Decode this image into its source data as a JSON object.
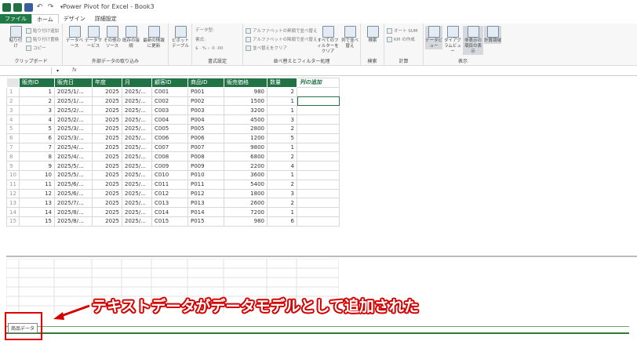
{
  "window": {
    "title": "Power Pivot for Excel - Book3"
  },
  "tabs": [
    "ファイル",
    "ホーム",
    "デザイン",
    "詳細設定"
  ],
  "ribbon": {
    "clipboard": {
      "label": "クリップボード",
      "paste": "貼り付け",
      "paste_append": "貼り付け追加",
      "paste_replace": "貼り付け置換",
      "copy": "コピー"
    },
    "external": {
      "label": "外部データの取り込み",
      "database": "データベース",
      "service": "データサービス",
      "other": "その他のソース",
      "existing": "既存の接続",
      "refresh": "最新の情報に更新"
    },
    "pivot": {
      "label": "ピボットテーブル"
    },
    "format": {
      "label": "書式設定",
      "datatype": "データ型:",
      "format": "書式:",
      "symbols": "$ · % › ·0 ·00"
    },
    "sort": {
      "label": "並べ替えとフィルター処理",
      "az": "アルファベットの昇順で並べ替え",
      "za": "アルファベットの降順で並べ替え",
      "clear_sort": "並べ替えをクリア",
      "clear_filter": "すべてのフィルターをクリア",
      "col_sort": "列で並べ替え"
    },
    "find": {
      "label": "検索",
      "find": "検索"
    },
    "calc": {
      "label": "計算",
      "autosum": "オート SUM",
      "kpi": "KPI の作成"
    },
    "view": {
      "label": "表示",
      "data": "データビュー",
      "diagram": "ダイアグラムビュー",
      "hidden": "非表示の項目の表示",
      "calc_area": "計算領域"
    }
  },
  "formula_bar": {
    "fx": "fx",
    "namebox_arrow": "▾"
  },
  "table": {
    "headers": [
      "販売ID",
      "販売日",
      "年度",
      "月",
      "顧客ID",
      "商品ID",
      "販売価格",
      "数量"
    ],
    "add_column": "列の追加",
    "rows": [
      [
        "1",
        "2025/1/...",
        "2025",
        "2025/...",
        "C001",
        "P001",
        "980",
        "2"
      ],
      [
        "2",
        "2025/1/...",
        "2025",
        "2025/...",
        "C002",
        "P002",
        "1500",
        "1"
      ],
      [
        "3",
        "2025/2/...",
        "2025",
        "2025/...",
        "C003",
        "P003",
        "3200",
        "1"
      ],
      [
        "4",
        "2025/2/...",
        "2025",
        "2025/...",
        "C004",
        "P004",
        "4500",
        "3"
      ],
      [
        "5",
        "2025/3/...",
        "2025",
        "2025/...",
        "C005",
        "P005",
        "2800",
        "2"
      ],
      [
        "6",
        "2025/3/...",
        "2025",
        "2025/...",
        "C006",
        "P006",
        "1200",
        "5"
      ],
      [
        "7",
        "2025/4/...",
        "2025",
        "2025/...",
        "C007",
        "P007",
        "9800",
        "1"
      ],
      [
        "8",
        "2025/4/...",
        "2025",
        "2025/...",
        "C008",
        "P008",
        "6800",
        "2"
      ],
      [
        "9",
        "2025/5/...",
        "2025",
        "2025/...",
        "C009",
        "P009",
        "2200",
        "4"
      ],
      [
        "10",
        "2025/5/...",
        "2025",
        "2025/...",
        "C010",
        "P010",
        "3600",
        "1"
      ],
      [
        "11",
        "2025/6/...",
        "2025",
        "2025/...",
        "C011",
        "P011",
        "5400",
        "2"
      ],
      [
        "12",
        "2025/6/...",
        "2025",
        "2025/...",
        "C012",
        "P012",
        "1800",
        "3"
      ],
      [
        "13",
        "2025/7/...",
        "2025",
        "2025/...",
        "C013",
        "P013",
        "2600",
        "2"
      ],
      [
        "14",
        "2025/8/...",
        "2025",
        "2025/...",
        "C014",
        "P014",
        "7200",
        "1"
      ],
      [
        "15",
        "2025/8/...",
        "2025",
        "2025/...",
        "C015",
        "P015",
        "980",
        "6"
      ]
    ]
  },
  "sheet_tab": "商品データ",
  "callout": "テキストデータがデータモデルとして追加された",
  "colors": {
    "excel_green": "#217346",
    "callout_red": "#e30000"
  }
}
